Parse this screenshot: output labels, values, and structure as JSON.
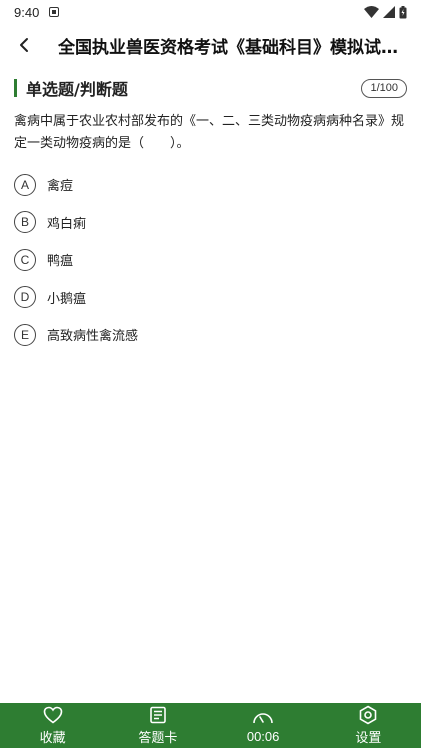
{
  "status_bar": {
    "time": "9:40"
  },
  "header": {
    "title": "全国执业兽医资格考试《基础科目》模拟试..."
  },
  "section": {
    "title": "单选题/判断题",
    "progress": "1/100"
  },
  "question": {
    "text": "禽病中属于农业农村部发布的《一、二、三类动物疫病病种名录》规定一类动物疫病的是（　　）。"
  },
  "options": [
    {
      "letter": "A",
      "text": "禽痘"
    },
    {
      "letter": "B",
      "text": "鸡白痢"
    },
    {
      "letter": "C",
      "text": "鸭瘟"
    },
    {
      "letter": "D",
      "text": "小鹅瘟"
    },
    {
      "letter": "E",
      "text": "高致病性禽流感"
    }
  ],
  "tabbar": {
    "favorite": "收藏",
    "answer_card": "答题卡",
    "timer": "00:06",
    "settings": "设置"
  },
  "colors": {
    "accent": "#2e7d32"
  },
  "icons": {
    "back": "chevron-left-icon",
    "favorite": "heart-icon",
    "answer_card": "answer-sheet-icon",
    "timer": "gauge-icon",
    "settings": "hexagon-gear-icon"
  }
}
